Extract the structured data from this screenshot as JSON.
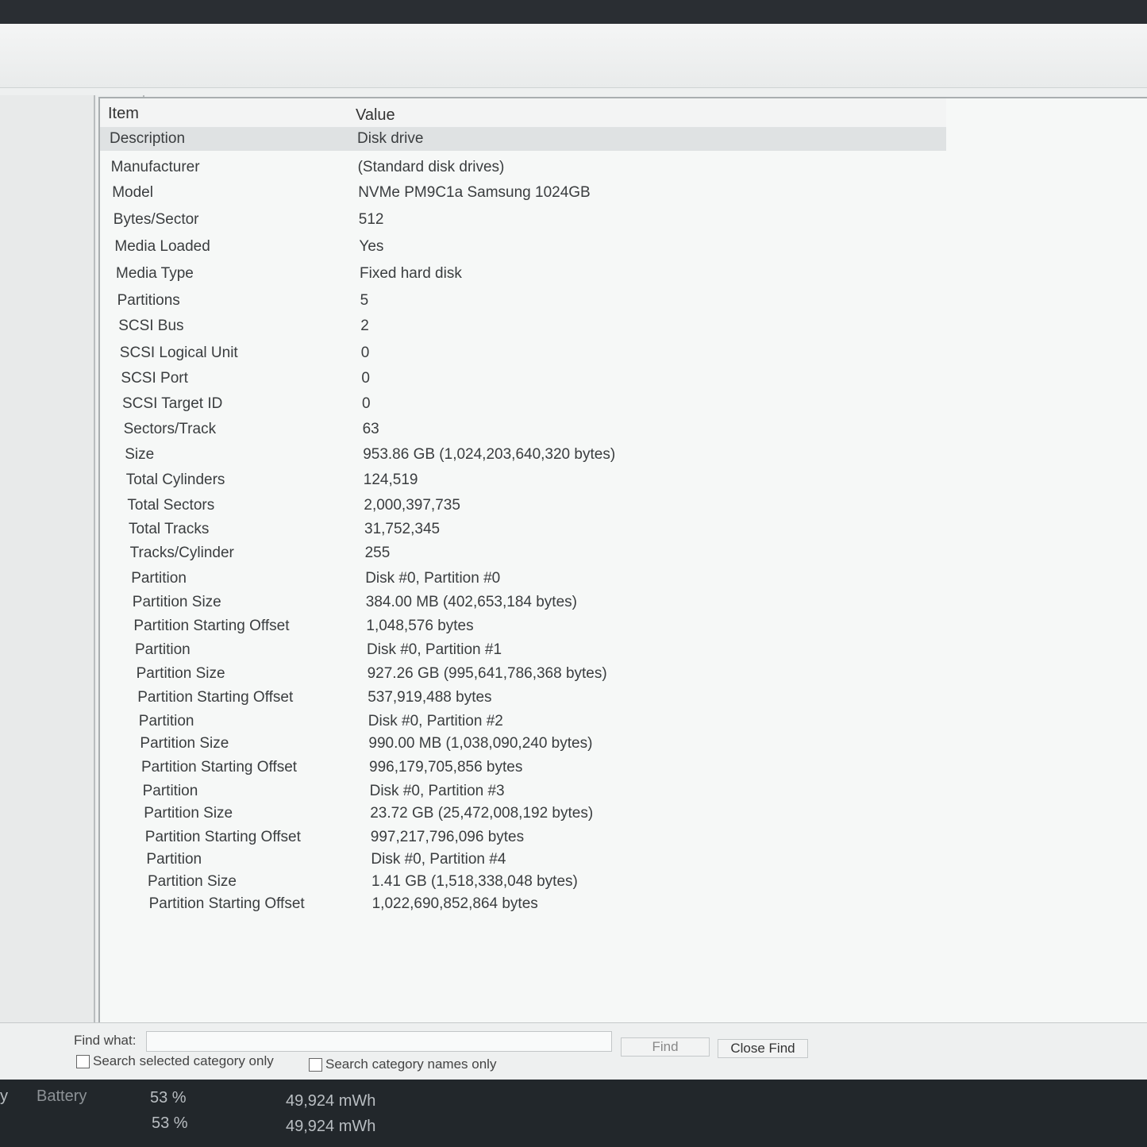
{
  "header": {
    "item": "Item",
    "value": "Value"
  },
  "rows": [
    {
      "item": "Description",
      "value": "Disk drive"
    },
    {
      "item": "Manufacturer",
      "value": "(Standard disk drives)"
    },
    {
      "item": "Model",
      "value": "NVMe PM9C1a Samsung 1024GB"
    },
    {
      "item": "Bytes/Sector",
      "value": "512"
    },
    {
      "item": "Media Loaded",
      "value": "Yes"
    },
    {
      "item": "Media Type",
      "value": "Fixed hard disk"
    },
    {
      "item": "Partitions",
      "value": "5"
    },
    {
      "item": "SCSI Bus",
      "value": "2"
    },
    {
      "item": "SCSI Logical Unit",
      "value": "0"
    },
    {
      "item": "SCSI Port",
      "value": "0"
    },
    {
      "item": "SCSI Target ID",
      "value": "0"
    },
    {
      "item": "Sectors/Track",
      "value": "63"
    },
    {
      "item": "Size",
      "value": "953.86 GB (1,024,203,640,320 bytes)"
    },
    {
      "item": "Total Cylinders",
      "value": "124,519"
    },
    {
      "item": "Total Sectors",
      "value": "2,000,397,735"
    },
    {
      "item": "Total Tracks",
      "value": "31,752,345"
    },
    {
      "item": "Tracks/Cylinder",
      "value": "255"
    },
    {
      "item": "Partition",
      "value": "Disk #0, Partition #0"
    },
    {
      "item": "Partition Size",
      "value": "384.00 MB (402,653,184 bytes)"
    },
    {
      "item": "Partition Starting Offset",
      "value": "1,048,576 bytes"
    },
    {
      "item": "Partition",
      "value": "Disk #0, Partition #1"
    },
    {
      "item": "Partition Size",
      "value": "927.26 GB (995,641,786,368 bytes)"
    },
    {
      "item": "Partition Starting Offset",
      "value": "537,919,488 bytes"
    },
    {
      "item": "Partition",
      "value": "Disk #0, Partition #2"
    },
    {
      "item": "Partition Size",
      "value": "990.00 MB (1,038,090,240 bytes)"
    },
    {
      "item": "Partition Starting Offset",
      "value": "996,179,705,856 bytes"
    },
    {
      "item": "Partition",
      "value": "Disk #0, Partition #3"
    },
    {
      "item": "Partition Size",
      "value": "23.72 GB (25,472,008,192 bytes)"
    },
    {
      "item": "Partition Starting Offset",
      "value": "997,217,796,096 bytes"
    },
    {
      "item": "Partition",
      "value": "Disk #0, Partition #4"
    },
    {
      "item": "Partition Size",
      "value": "1.41 GB (1,518,338,048 bytes)"
    },
    {
      "item": "Partition Starting Offset",
      "value": "1,022,690,852,864 bytes"
    }
  ],
  "find": {
    "label": "Find what:",
    "value": "",
    "find_button": "Find",
    "close_button": "Close Find",
    "search_selected": "Search selected category only",
    "search_names": "Search category names only"
  },
  "taskbar": {
    "left_char": "y",
    "battery_label": "Battery",
    "row1_percent": "53 %",
    "row1_energy": "49,924 mWh",
    "row2_percent": "53 %",
    "row2_energy": "49,924 mWh"
  }
}
